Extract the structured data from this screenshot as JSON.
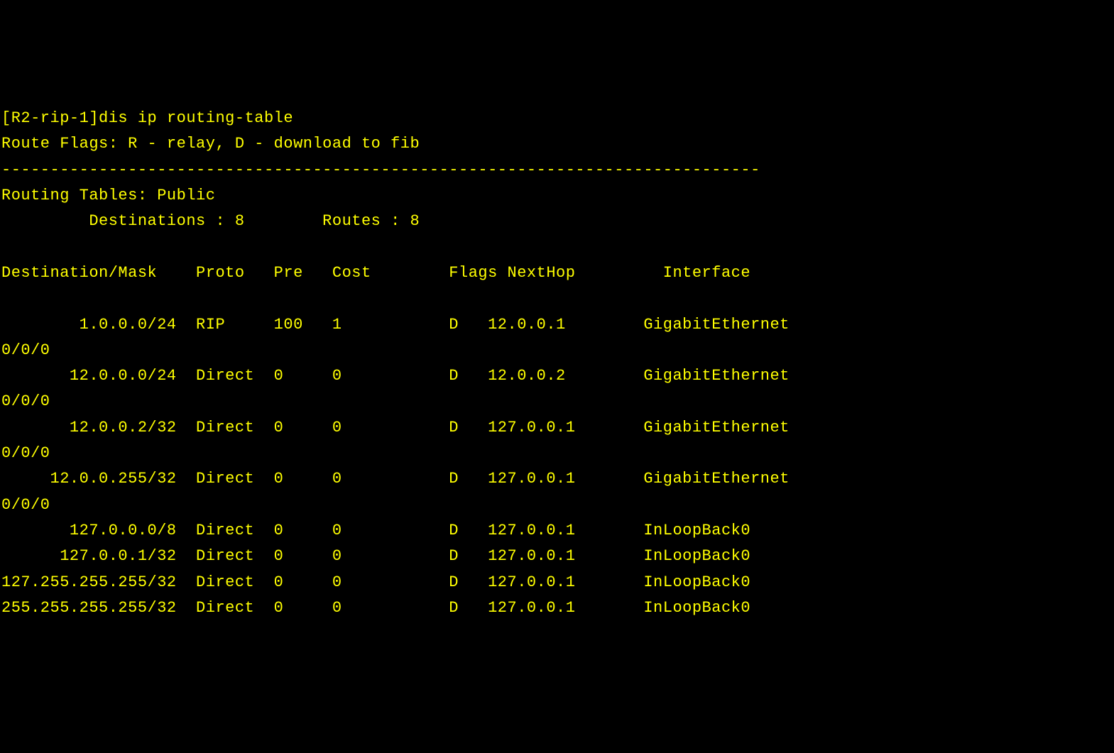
{
  "prompt": "[R2-rip-1]",
  "command": "dis ip routing-table",
  "flags_legend": "Route Flags: R - relay, D - download to fib",
  "separator": "------------------------------------------------------------------------------",
  "table_header": "Routing Tables: Public",
  "summary_line": "         Destinations : 8        Routes : 8",
  "columns": {
    "dest": "Destination/Mask",
    "proto": "Proto",
    "pre": "Pre",
    "cost": "Cost",
    "flags": "Flags",
    "nexthop": "NextHop",
    "interface": "Interface"
  },
  "routes": [
    {
      "dest": "1.0.0.0/24",
      "proto": "RIP",
      "pre": "100",
      "cost": "1",
      "flags": "D",
      "nexthop": "12.0.0.1",
      "interface": "GigabitEthernet",
      "iface_wrap": "0/0/0"
    },
    {
      "dest": "12.0.0.0/24",
      "proto": "Direct",
      "pre": "0",
      "cost": "0",
      "flags": "D",
      "nexthop": "12.0.0.2",
      "interface": "GigabitEthernet",
      "iface_wrap": "0/0/0"
    },
    {
      "dest": "12.0.0.2/32",
      "proto": "Direct",
      "pre": "0",
      "cost": "0",
      "flags": "D",
      "nexthop": "127.0.0.1",
      "interface": "GigabitEthernet",
      "iface_wrap": "0/0/0"
    },
    {
      "dest": "12.0.0.255/32",
      "proto": "Direct",
      "pre": "0",
      "cost": "0",
      "flags": "D",
      "nexthop": "127.0.0.1",
      "interface": "GigabitEthernet",
      "iface_wrap": "0/0/0"
    },
    {
      "dest": "127.0.0.0/8",
      "proto": "Direct",
      "pre": "0",
      "cost": "0",
      "flags": "D",
      "nexthop": "127.0.0.1",
      "interface": "InLoopBack0",
      "iface_wrap": ""
    },
    {
      "dest": "127.0.0.1/32",
      "proto": "Direct",
      "pre": "0",
      "cost": "0",
      "flags": "D",
      "nexthop": "127.0.0.1",
      "interface": "InLoopBack0",
      "iface_wrap": ""
    },
    {
      "dest": "127.255.255.255/32",
      "proto": "Direct",
      "pre": "0",
      "cost": "0",
      "flags": "D",
      "nexthop": "127.0.0.1",
      "interface": "InLoopBack0",
      "iface_wrap": ""
    },
    {
      "dest": "255.255.255.255/32",
      "proto": "Direct",
      "pre": "0",
      "cost": "0",
      "flags": "D",
      "nexthop": "127.0.0.1",
      "interface": "InLoopBack0",
      "iface_wrap": ""
    }
  ]
}
